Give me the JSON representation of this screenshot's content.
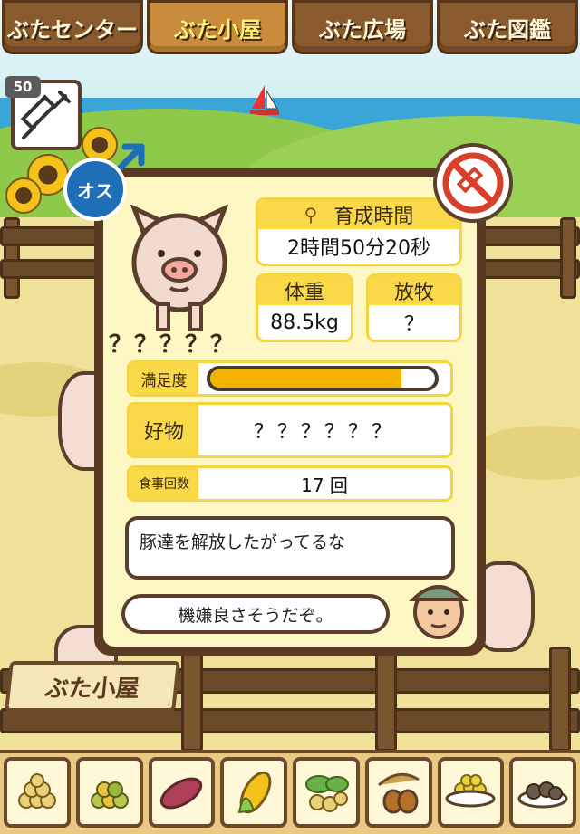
{
  "tabs": [
    {
      "label": "ぶたセンター",
      "active": false
    },
    {
      "label": "ぶた小屋",
      "active": true
    },
    {
      "label": "ぶた広場",
      "active": false
    },
    {
      "label": "ぶた図鑑",
      "active": false
    }
  ],
  "item": {
    "count": "50",
    "icon": "syringe-icon"
  },
  "pig": {
    "gender_label": "オス",
    "name": "？？？？？",
    "icon": "pig-icon"
  },
  "stats": {
    "raise_time_label": "育成時間",
    "raise_time_value": "2時間50分20秒",
    "weight_label": "体重",
    "weight_value": "88.5kg",
    "graze_label": "放牧",
    "graze_value": "？",
    "satisfaction_label": "満足度",
    "satisfaction_level": 0.85,
    "favorite_label": "好物",
    "favorite_value": "？？？？？？",
    "meals_label": "食事回数",
    "meals_value": "17 回"
  },
  "dialog": {
    "message1": "豚達を解放したがってるな",
    "message2": "機嫌良さそうだぞ。"
  },
  "sign": {
    "label": "ぶた小屋"
  },
  "colors": {
    "accent": "#f9d948",
    "wood": "#6b4a2a",
    "bar_fill": "#f2b400",
    "gender": "#1f6fb8",
    "no_inject": "#d9402b"
  },
  "food_items": [
    {
      "icon": "soybean-icon"
    },
    {
      "icon": "mixed-beans-icon"
    },
    {
      "icon": "sweet-potato-icon"
    },
    {
      "icon": "corn-icon"
    },
    {
      "icon": "vegetables-icon"
    },
    {
      "icon": "acorn-icon"
    },
    {
      "icon": "corn-bowl-icon"
    },
    {
      "icon": "meatball-plate-icon"
    }
  ]
}
